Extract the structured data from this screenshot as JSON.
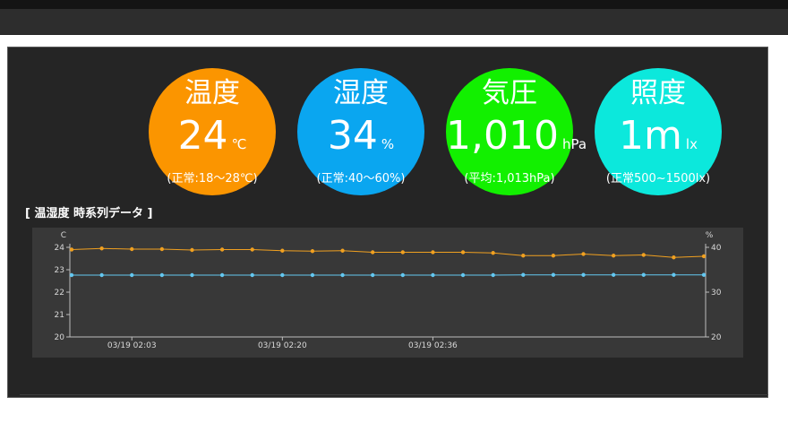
{
  "gauges": [
    {
      "id": "temperature",
      "label": "温度",
      "value": "24",
      "unit": "℃",
      "range": "(正常:18～28℃)",
      "color": "#fb9500"
    },
    {
      "id": "humidity",
      "label": "湿度",
      "value": "34",
      "unit": "%",
      "range": "(正常:40～60%)",
      "color": "#0aa6f0"
    },
    {
      "id": "pressure",
      "label": "気圧",
      "value": "1,010",
      "unit": "hPa",
      "range": "(平均:1,013hPa)",
      "color": "#12f000"
    },
    {
      "id": "illuminance",
      "label": "照度",
      "value": "1m",
      "unit": "lx",
      "range": "(正常500~1500lx)",
      "color": "#0ce8dc"
    }
  ],
  "chart_section": {
    "title": "[ 温湿度 時系列データ ]"
  },
  "chart_data": {
    "type": "line",
    "x": [
      "03/19 01:56",
      "03/19 01:59",
      "03/19 02:03",
      "03/19 02:06",
      "03/19 02:10",
      "03/19 02:13",
      "03/19 02:16",
      "03/19 02:20",
      "03/19 02:23",
      "03/19 02:26",
      "03/19 02:29",
      "03/19 02:32",
      "03/19 02:36",
      "03/19 02:39",
      "03/19 02:42",
      "03/19 02:45",
      "03/19 02:49",
      "03/19 02:52",
      "03/19 02:55",
      "03/19 02:59",
      "03/19 03:02",
      "03/19 03:05"
    ],
    "x_ticks": [
      "03/19 02:03",
      "03/19 02:20",
      "03/19 02:36"
    ],
    "y_left": {
      "label": "C",
      "range": [
        20,
        24
      ],
      "ticks": [
        20,
        21,
        22,
        23,
        24
      ]
    },
    "y_right": {
      "label": "%",
      "range": [
        20,
        40
      ],
      "ticks": [
        20,
        30,
        40
      ]
    },
    "series": [
      {
        "axis": "left",
        "color": "#f0a020",
        "values": [
          23.9,
          23.95,
          23.92,
          23.92,
          23.88,
          23.9,
          23.9,
          23.85,
          23.83,
          23.85,
          23.78,
          23.78,
          23.78,
          23.78,
          23.75,
          23.63,
          23.63,
          23.7,
          23.63,
          23.66,
          23.55,
          23.6
        ]
      },
      {
        "axis": "right",
        "color": "#63c7f0",
        "values": [
          33.8,
          33.8,
          33.8,
          33.8,
          33.8,
          33.8,
          33.8,
          33.8,
          33.8,
          33.8,
          33.8,
          33.8,
          33.8,
          33.8,
          33.8,
          33.85,
          33.85,
          33.85,
          33.85,
          33.85,
          33.85,
          33.85
        ]
      }
    ]
  }
}
